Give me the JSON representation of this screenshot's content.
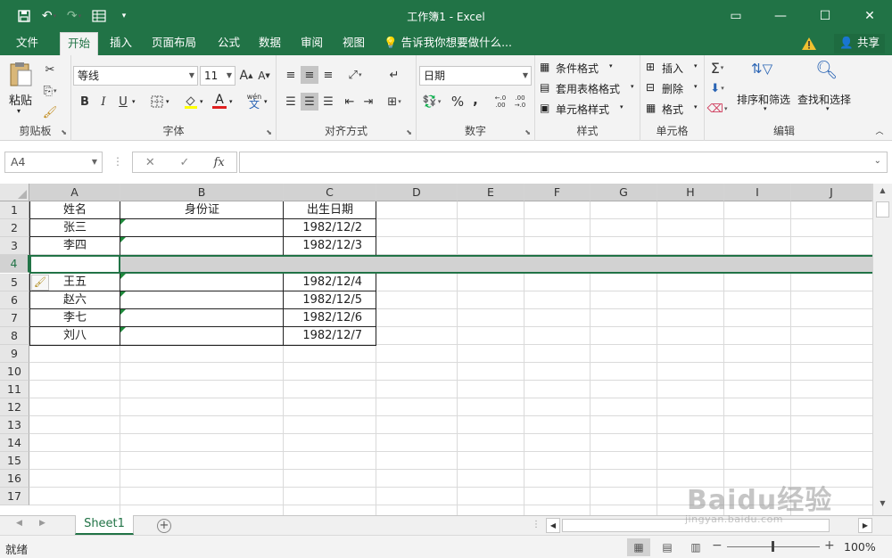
{
  "window": {
    "title": "工作簿1 - Excel",
    "controls": {
      "ribbon_display": "▭",
      "minimize": "—",
      "maximize": "☐",
      "close": "✕"
    }
  },
  "qat": {
    "save_icon": "save-icon",
    "undo_icon": "undo-icon",
    "redo_icon": "redo-icon",
    "form_icon": "form-icon",
    "customize_icon": "customize-icon"
  },
  "tabs": [
    {
      "label": "文件"
    },
    {
      "label": "开始"
    },
    {
      "label": "插入"
    },
    {
      "label": "页面布局"
    },
    {
      "label": "公式"
    },
    {
      "label": "数据"
    },
    {
      "label": "审阅"
    },
    {
      "label": "视图"
    }
  ],
  "tell_me": "告诉我你想要做什么...",
  "share": "共享",
  "ribbon": {
    "clipboard": {
      "label": "剪贴板",
      "paste": "粘贴"
    },
    "font": {
      "label": "字体",
      "name": "等线",
      "size": "11",
      "bold": "B",
      "italic": "I",
      "underline": "U",
      "font_color": "A",
      "phonetic": "wén"
    },
    "alignment": {
      "label": "对齐方式"
    },
    "number": {
      "label": "数字",
      "format": "日期",
      "percent": "%",
      "comma": ","
    },
    "styles": {
      "label": "样式",
      "conditional": "条件格式",
      "table": "套用表格格式",
      "cell_styles": "单元格样式"
    },
    "cells": {
      "label": "单元格",
      "insert": "插入",
      "delete": "删除",
      "format": "格式"
    },
    "editing": {
      "label": "编辑",
      "sort_filter": "排序和筛选",
      "find_select": "查找和选择"
    }
  },
  "formula_bar": {
    "name_box": "A4",
    "cancel": "✕",
    "enter": "✓",
    "fx": "fx",
    "value": ""
  },
  "columns": [
    "A",
    "B",
    "C",
    "D",
    "E",
    "F",
    "G",
    "H",
    "I",
    "J"
  ],
  "rows": [
    "1",
    "2",
    "3",
    "4",
    "5",
    "6",
    "7",
    "8",
    "9",
    "10",
    "11",
    "12",
    "13",
    "14",
    "15",
    "16",
    "17"
  ],
  "table": {
    "headers": [
      "姓名",
      "身份证",
      "出生日期"
    ],
    "data": [
      {
        "row": "2",
        "name": "张三",
        "id": "",
        "birth": "1982/12/2"
      },
      {
        "row": "3",
        "name": "李四",
        "id": "",
        "birth": "1982/12/3"
      },
      {
        "row": "4",
        "name": "",
        "id": "",
        "birth": ""
      },
      {
        "row": "5",
        "name": "王五",
        "id": "",
        "birth": "1982/12/4"
      },
      {
        "row": "6",
        "name": "赵六",
        "id": "",
        "birth": "1982/12/5"
      },
      {
        "row": "7",
        "name": "李七",
        "id": "",
        "birth": "1982/12/6"
      },
      {
        "row": "8",
        "name": "刘八",
        "id": "",
        "birth": "1982/12/7"
      }
    ]
  },
  "sheet_tabs": [
    {
      "label": "Sheet1"
    }
  ],
  "status": {
    "text": "就绪",
    "zoom": "100%",
    "zoom_minus": "−",
    "zoom_plus": "+"
  },
  "watermark": {
    "line1": "Baidu经验",
    "line2": "jingyan.baidu.com"
  },
  "colors": {
    "accent": "#217346",
    "selection": "#d2d2d2",
    "comment_flag": "#1e8a3b"
  }
}
